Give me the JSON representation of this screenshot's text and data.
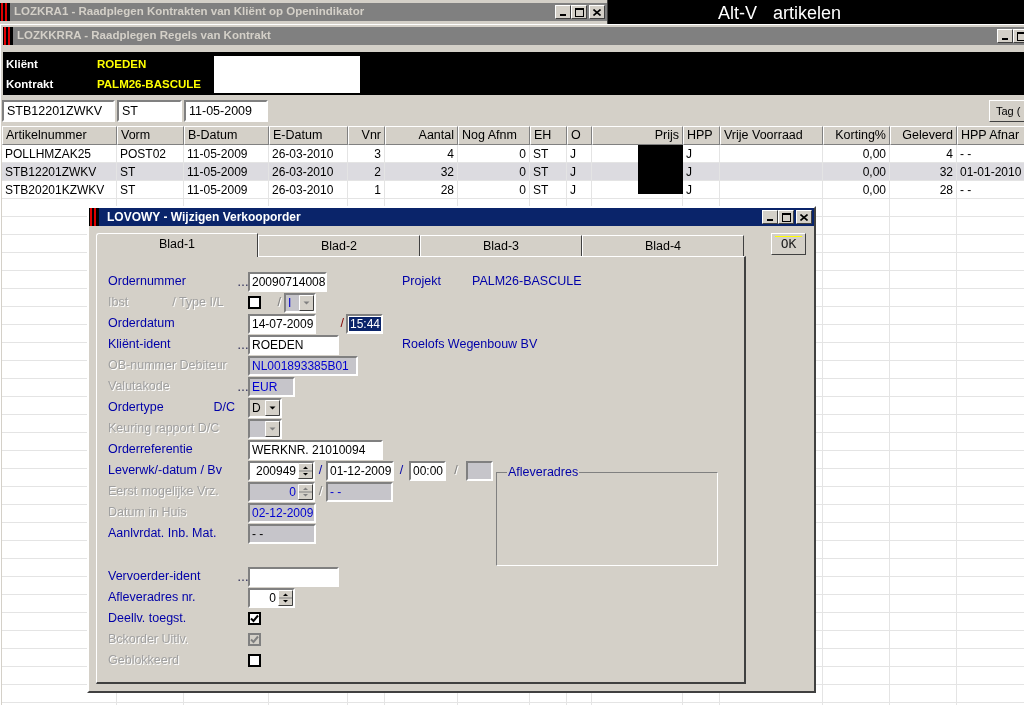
{
  "contract_window": {
    "title": "LOZKRA1 - Raadplegen Kontrakten van Kliënt op Openindikator"
  },
  "shortcut_hint": {
    "key": "Alt-V",
    "action": "artikelen"
  },
  "lines_window": {
    "title": "LOZKKRRA - Raadplegen Regels van Kontrakt",
    "header": [
      {
        "label": "Kliënt",
        "value": "ROEDEN"
      },
      {
        "label": "Kontrakt",
        "value": "PALM26-BASCULE"
      }
    ],
    "filter_fields": [
      "STB12201ZWKV",
      "ST",
      "11-05-2009"
    ],
    "tag_button": "Tag (",
    "table": {
      "columns": [
        "Artikelnummer",
        "Vorm",
        "B-Datum",
        "E-Datum",
        "Vnr",
        "Aantal",
        "Nog Afnm",
        "EH",
        "O",
        "Prijs",
        "HPP",
        "Vrije Voorraad",
        "Korting%",
        "Geleverd",
        "HPP Afnar"
      ],
      "price_redacted": true,
      "rows": [
        {
          "selected": false,
          "cells": [
            "POLLHMZAK25",
            "POST02",
            "11-05-2009",
            "26-03-2010",
            "3",
            "4",
            "0",
            "ST",
            "J",
            null,
            "J",
            null,
            "0,00",
            "4",
            "- -"
          ]
        },
        {
          "selected": true,
          "cells": [
            "STB12201ZWKV",
            "ST",
            "11-05-2009",
            "26-03-2010",
            "2",
            "32",
            "0",
            "ST",
            "J",
            null,
            "J",
            null,
            "0,00",
            "32",
            "01-01-2010"
          ]
        },
        {
          "selected": false,
          "cells": [
            "STB20201KZWKV",
            "ST",
            "11-05-2009",
            "26-03-2010",
            "1",
            "28",
            "0",
            "ST",
            "J",
            null,
            "J",
            null,
            "0,00",
            "28",
            "- -"
          ]
        }
      ]
    }
  },
  "order_dialog": {
    "title": "LOVOWY - Wijzigen Verkooporder",
    "tabs": [
      {
        "label": "Blad-1",
        "selected": true
      },
      {
        "label": "Blad-2",
        "selected": false
      },
      {
        "label": "Blad-3",
        "selected": false
      },
      {
        "label": "Blad-4",
        "selected": false
      }
    ],
    "ok_button": "OK",
    "sections": [
      [
        {
          "label": "Ordernummer",
          "disabled": false,
          "lookup": "…",
          "controls": [
            {
              "kind": "text",
              "value": "20090714008",
              "disabled": false,
              "selected": false
            }
          ],
          "aside": {
            "label": "Projekt",
            "value": "PALM26-BASCULE"
          }
        },
        {
          "label": "Ibst",
          "suffix": "/ Type I/L",
          "disabled": true,
          "controls": [
            {
              "kind": "checkbox",
              "checked": false,
              "disabled": false
            },
            {
              "kind": "separator",
              "text": "/",
              "disabled": true,
              "alert": false
            },
            {
              "kind": "dropdown",
              "value": "I",
              "disabled": true
            }
          ]
        },
        {
          "label": "Orderdatum",
          "disabled": false,
          "controls": [
            {
              "kind": "text",
              "value": "14-07-2009",
              "disabled": false,
              "selected": false
            },
            {
              "kind": "separator",
              "text": "/",
              "disabled": false,
              "alert": true
            },
            {
              "kind": "text",
              "value": "15:44",
              "disabled": false,
              "selected": true
            }
          ]
        },
        {
          "label": "Kliënt-ident",
          "disabled": false,
          "lookup": "…",
          "controls": [
            {
              "kind": "text",
              "value": "ROEDEN",
              "disabled": false,
              "selected": false
            }
          ],
          "aside": {
            "value": "Roelofs Wegenbouw BV"
          }
        },
        {
          "label": "OB-nummer Debiteur",
          "disabled": true,
          "controls": [
            {
              "kind": "text",
              "value": "NL001893385B01",
              "disabled": true,
              "selected": false
            }
          ]
        },
        {
          "label": "Valutakode",
          "disabled": true,
          "lookup": "…",
          "controls": [
            {
              "kind": "text",
              "value": "EUR",
              "disabled": true,
              "selected": false
            }
          ]
        },
        {
          "label": "Ordertype",
          "suffix": "D/C",
          "disabled": false,
          "controls": [
            {
              "kind": "dropdown",
              "value": "D",
              "disabled": false
            }
          ]
        },
        {
          "label": "Keuring rapport D/C",
          "disabled": true,
          "controls": [
            {
              "kind": "dropdown",
              "disabled": true
            }
          ]
        },
        {
          "label": "Orderreferentie",
          "disabled": false,
          "controls": [
            {
              "kind": "text",
              "value": "WERKNR. 21010094",
              "disabled": false,
              "selected": false
            }
          ]
        },
        {
          "label": "Leverwk/-datum / Bv",
          "disabled": false,
          "controls": [
            {
              "kind": "spin",
              "value": "200949",
              "disabled": false
            },
            {
              "kind": "separator",
              "text": "/",
              "disabled": false,
              "alert": false
            },
            {
              "kind": "text",
              "value": "01-12-2009",
              "disabled": false,
              "selected": false
            },
            {
              "kind": "separator",
              "text": "/",
              "disabled": false,
              "alert": false
            },
            {
              "kind": "text",
              "value": "00:00",
              "disabled": false,
              "selected": false
            },
            {
              "kind": "separator",
              "text": "/",
              "disabled": true,
              "alert": false
            },
            {
              "kind": "text",
              "disabled": true
            }
          ],
          "group_box": "Afleveradres"
        },
        {
          "label": "Eerst mogelijke Vrz.",
          "disabled": true,
          "controls": [
            {
              "kind": "spin",
              "value": "0",
              "disabled": true
            },
            {
              "kind": "separator",
              "text": "/",
              "disabled": true,
              "alert": false
            },
            {
              "kind": "text",
              "value": "- -",
              "disabled": true,
              "selected": false
            }
          ]
        },
        {
          "label": "Datum in Huis",
          "disabled": true,
          "controls": [
            {
              "kind": "text",
              "value": "02-12-2009",
              "disabled": true,
              "selected": false
            }
          ]
        },
        {
          "label": "Aanlvrdat. Inb. Mat.",
          "disabled": false,
          "controls": [
            {
              "kind": "readout",
              "value": "- -"
            }
          ]
        }
      ],
      [
        {
          "label": "Vervoerder-ident",
          "disabled": false,
          "lookup": "…",
          "controls": [
            {
              "kind": "text",
              "disabled": false
            }
          ]
        },
        {
          "label": "Afleveradres nr.",
          "disabled": false,
          "controls": [
            {
              "kind": "spin",
              "value": "0",
              "disabled": false
            }
          ]
        },
        {
          "label": "Deellv. toegst.",
          "disabled": false,
          "controls": [
            {
              "kind": "checkbox",
              "checked": true,
              "disabled": false
            }
          ]
        },
        {
          "label": "Bckorder Uitlv.",
          "disabled": true,
          "controls": [
            {
              "kind": "checkbox",
              "checked": true,
              "disabled": true
            }
          ]
        },
        {
          "label": "Geblokkeerd",
          "disabled": true,
          "controls": [
            {
              "kind": "checkbox",
              "checked": false,
              "disabled": false
            }
          ]
        }
      ]
    ]
  }
}
